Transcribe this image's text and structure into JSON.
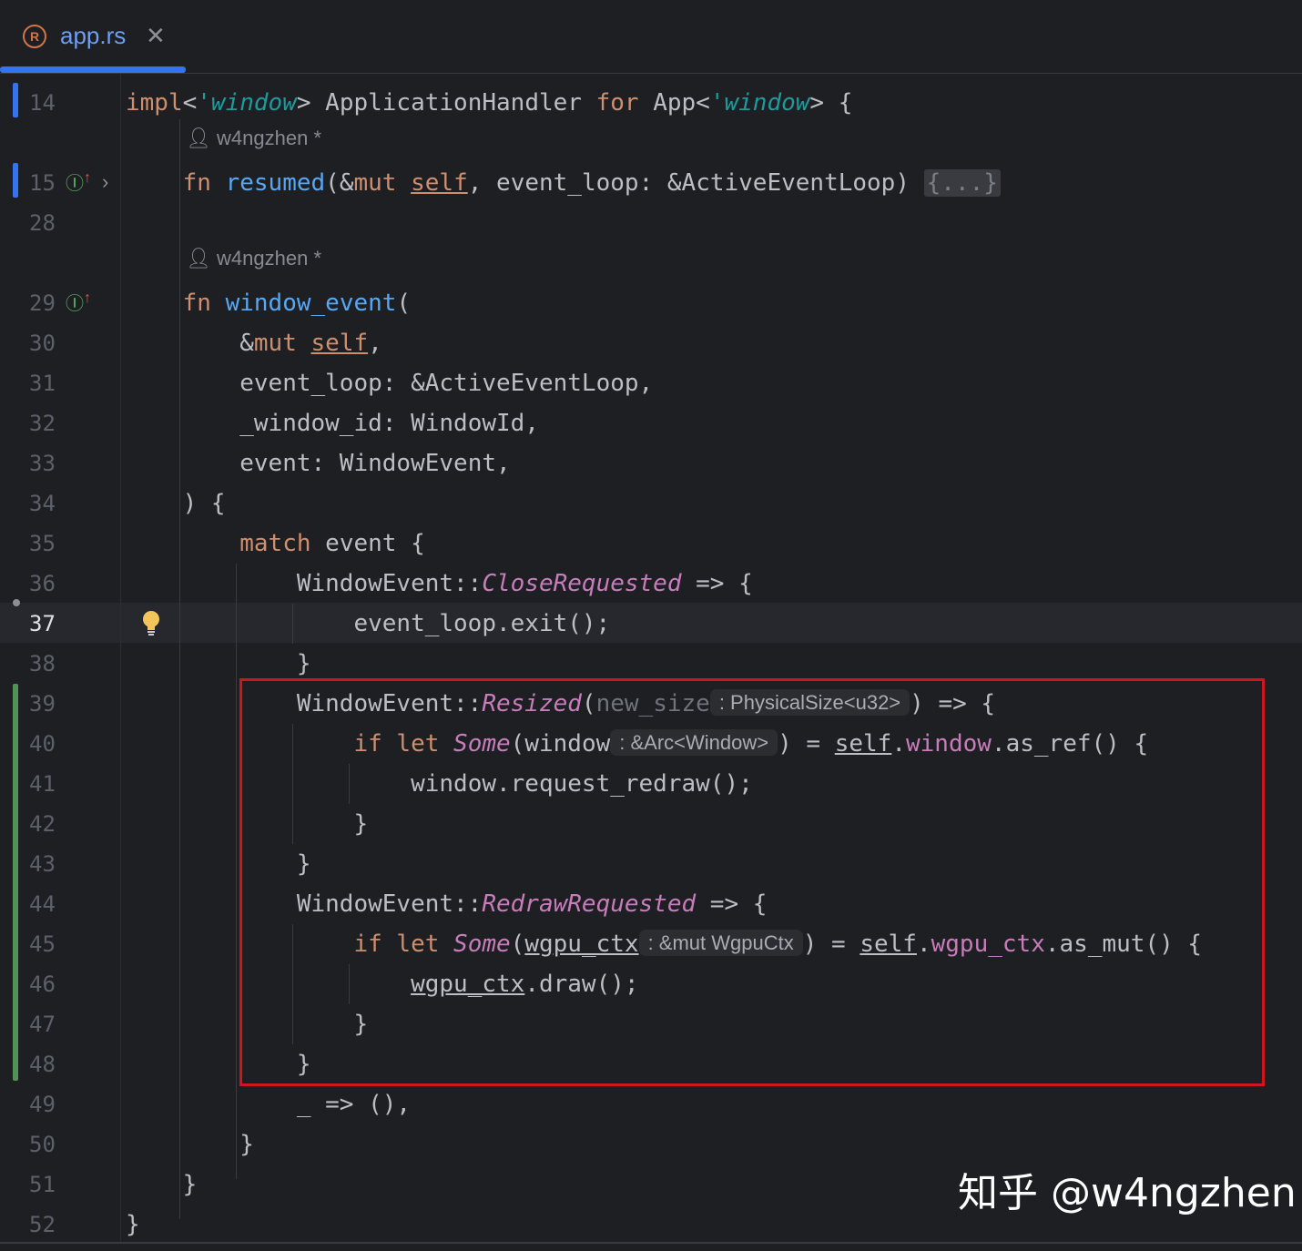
{
  "tab": {
    "label": "app.rs",
    "close": "✕",
    "icon": "rust-file-icon",
    "icon_glyph": "R"
  },
  "colors": {
    "background": "#1e1f22",
    "keyword": "#cf8e6d",
    "function": "#56a8f5",
    "lifetime": "#20999d",
    "enum_variant": "#c77dbb",
    "highlight_box": "#d1151c"
  },
  "gutter": {
    "line_numbers": [
      "14",
      "15",
      "28",
      "29",
      "30",
      "31",
      "32",
      "33",
      "34",
      "35",
      "36",
      "37",
      "38",
      "39",
      "40",
      "41",
      "42",
      "43",
      "44",
      "45",
      "46",
      "47",
      "48",
      "49",
      "50",
      "51",
      "52"
    ],
    "active_line": "37"
  },
  "code_vision": {
    "author_1": "w4ngzhen *",
    "author_2": "w4ngzhen *"
  },
  "code": {
    "l14": {
      "impl": "impl",
      "lt1": "'window",
      "mid": "> ApplicationHandler ",
      "for": "for",
      "app": " App<",
      "lt2": "'window",
      "end": "> {"
    },
    "l15": {
      "fn": "fn",
      "name": "resumed",
      "p1": "(&",
      "mut": "mut",
      "sp": " ",
      "self": "self",
      "rest": ", event_loop: &ActiveEventLoop) ",
      "fold": "{...}"
    },
    "l29": {
      "fn": "fn",
      "name": "window_event",
      "paren": "("
    },
    "l30": {
      "amp": "&",
      "mut": "mut",
      "sp": " ",
      "self": "self",
      "comma": ","
    },
    "l31": "event_loop: &ActiveEventLoop,",
    "l32": "_window_id: WindowId,",
    "l33": "event: WindowEvent,",
    "l34": ") {",
    "l35": {
      "match": "match",
      "rest": " event {"
    },
    "l36": {
      "p1": "WindowEvent::",
      "variant": "CloseRequested",
      "rest": " => {"
    },
    "l37": "event_loop.exit();",
    "l38": "}",
    "l39": {
      "p1": "WindowEvent::",
      "variant": "Resized",
      "paren": "(",
      "param": "new_size",
      "hint": ": PhysicalSize<u32>",
      "rest": ") => {"
    },
    "l40": {
      "if": "if",
      "let": "let",
      "some": "Some",
      "paren": "(window",
      "hint": ": &Arc<Window>",
      "eq": ") = ",
      "self": "self",
      "dot": ".",
      "field": "window",
      "rest": ".as_ref() {"
    },
    "l41": "window.request_redraw();",
    "l42": "}",
    "l43": "}",
    "l44": {
      "p1": "WindowEvent::",
      "variant": "RedrawRequested",
      "rest": " => {"
    },
    "l45": {
      "if": "if",
      "let": "let",
      "some": "Some",
      "paren": "(",
      "var": "wgpu_ctx",
      "hint": ": &mut WgpuCtx",
      "eq": ") = ",
      "self": "self",
      "dot": ".",
      "field": "wgpu_ctx",
      "rest": ".as_mut() {"
    },
    "l46": {
      "var": "wgpu_ctx",
      "rest": ".draw();"
    },
    "l47": "}",
    "l48": "}",
    "l49": "_ => (),",
    "l50": "}",
    "l51": "}",
    "l52": "}"
  },
  "watermark": "知乎 @w4ngzhen"
}
